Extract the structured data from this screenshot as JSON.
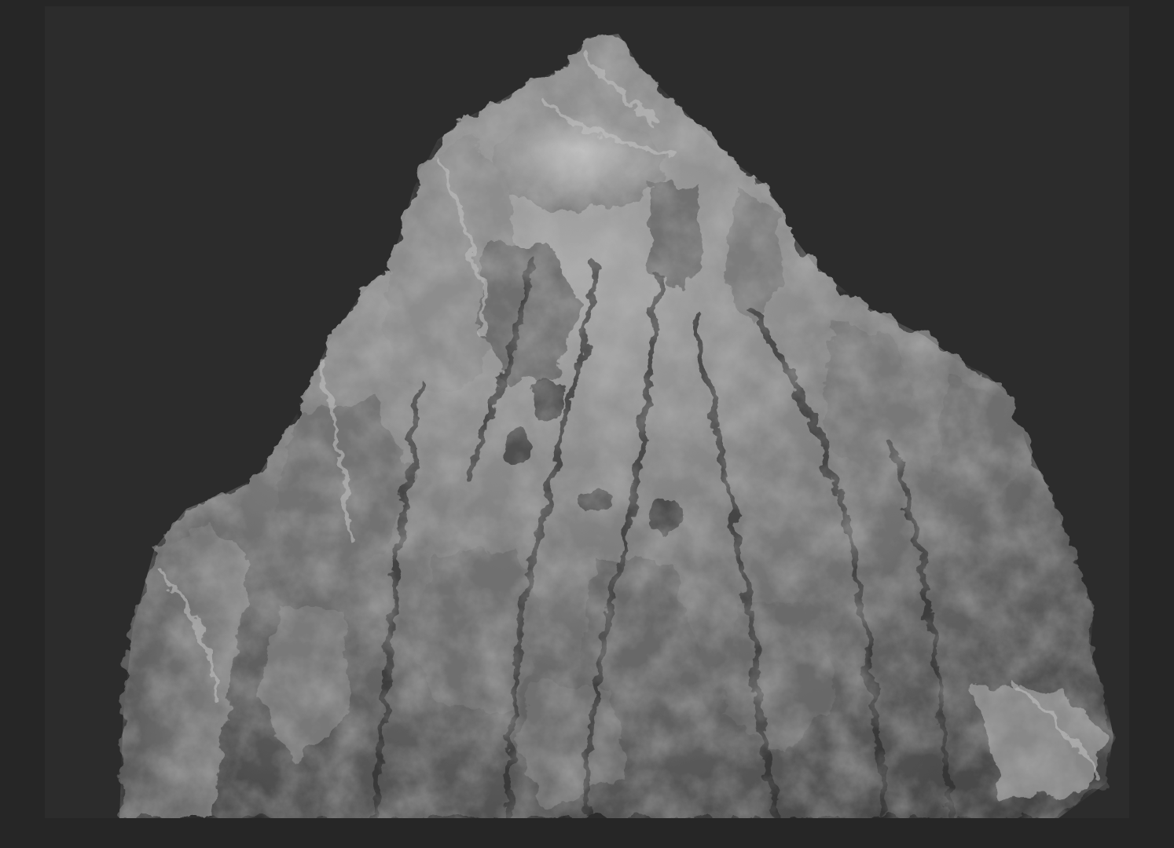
{
  "scene": {
    "subject_icon": "sculpted-rock-mound",
    "colors": {
      "outer_frame": "#262626",
      "viewport_background": "#2c2c2c",
      "mesh_base": "#7a7a7a",
      "mesh_highlight": "#c8c8c8",
      "mesh_shadow": "#2a2a2a"
    }
  }
}
